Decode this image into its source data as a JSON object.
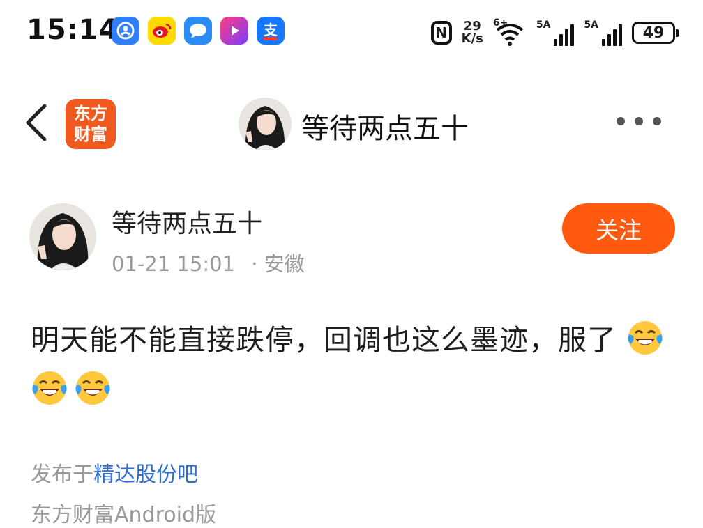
{
  "status_bar": {
    "time": "15:14",
    "net_speed_value": "29",
    "net_speed_unit": "K/s",
    "wifi_label": "6+",
    "sim1_label": "5A",
    "sim2_label": "5A",
    "battery": "49",
    "app_icons": [
      "profile-app-icon",
      "weibo-icon",
      "message-app-icon",
      "video-app-icon",
      "alipay-icon"
    ]
  },
  "nav": {
    "logo_line1": "东方",
    "logo_line2": "财富",
    "title": "等待两点五十"
  },
  "post": {
    "author": "等待两点五十",
    "date": "01-21 15:01",
    "location": "· 安徽",
    "follow_label": "关注",
    "text": "明天能不能直接跌停，回调也这么墨迹，服了",
    "emoji": [
      "laughing-tears-emoji",
      "laughing-tears-emoji",
      "laughing-tears-emoji"
    ],
    "forum_prefix": "发布于",
    "forum_name": "精达股份吧",
    "client": "东方财富Android版"
  },
  "colors": {
    "accent": "#ff5a0f",
    "logo": "#f05a1e",
    "link": "#2f6fd3",
    "meta": "#9a9a9a"
  }
}
